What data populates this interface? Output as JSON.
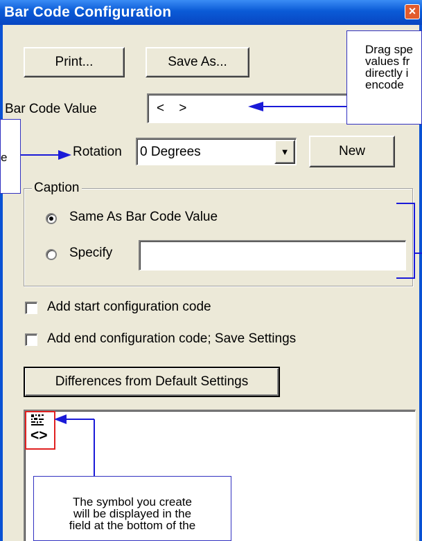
{
  "window": {
    "title": "Bar Code Configuration",
    "close_glyph": "×"
  },
  "buttons": {
    "print": "Print...",
    "save_as": "Save As...",
    "new": "New",
    "differences": "Differences from Default Settings"
  },
  "barcode_value": {
    "label": "Bar Code Value",
    "value": "<    >"
  },
  "rotation": {
    "label": "Rotation",
    "selected": "0 Degrees",
    "arrow_glyph": "▼"
  },
  "caption": {
    "group_label": "Caption",
    "option_same": "Same As Bar Code Value",
    "option_specify": "Specify",
    "selected": "same",
    "specify_value": ""
  },
  "checkboxes": {
    "start_code": {
      "label": "Add start configuration code",
      "checked": false
    },
    "end_code": {
      "label": "Add end configuration code; Save Settings",
      "checked": false
    }
  },
  "preview": {
    "symbol_text": "<>"
  },
  "callouts": {
    "top_right": [
      "Drag spe",
      "values fr",
      "directly i",
      "encode"
    ],
    "left": [
      "e"
    ],
    "bottom": [
      "The symbol you create",
      "will be displayed in the",
      "field at the bottom of the"
    ]
  },
  "colors": {
    "title_bar": "#0a5ad6",
    "dialog": "#ece9d8",
    "callout_line": "#1a1ad8",
    "preview_highlight": "#e02020"
  }
}
